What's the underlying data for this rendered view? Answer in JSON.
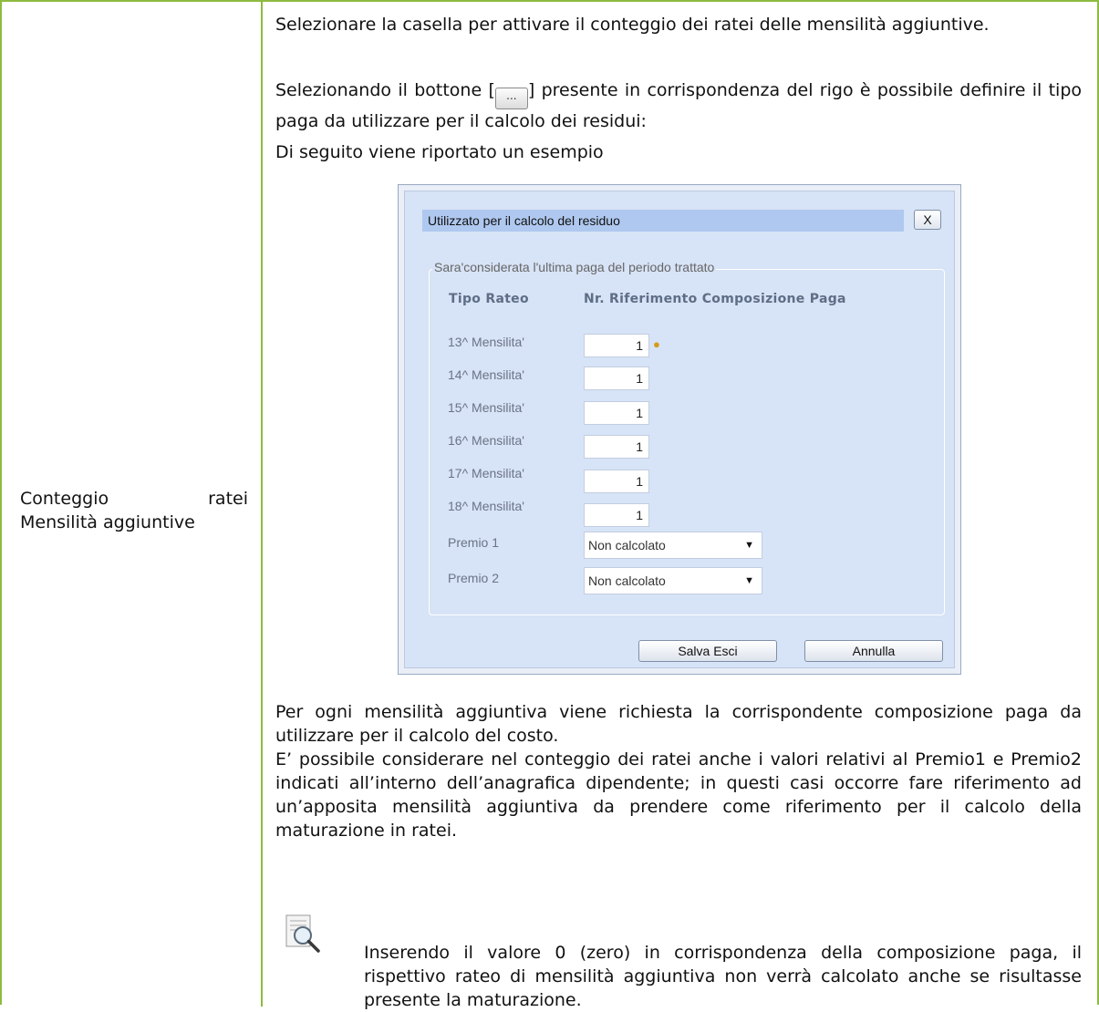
{
  "left_cell": {
    "label_line1_a": "Conteggio",
    "label_line1_b": "ratei",
    "label_line2": "Mensilità aggiuntive"
  },
  "right_cell": {
    "para1": "Selezionare la casella per attivare il conteggio dei ratei delle mensilità aggiuntive.",
    "para2_before": "Selezionando il bottone [",
    "inline_button_label": "...",
    "para2_after": "] presente in corrispondenza del rigo è possibile definire il tipo paga da utilizzare per il calcolo dei residui:",
    "para3": "Di seguito viene riportato un esempio",
    "para4": "Per ogni mensilità aggiuntiva viene richiesta la corrispondente composizione paga da utilizzare per il calcolo del costo.",
    "para5": "E’ possibile considerare nel conteggio dei ratei anche i valori relativi al Premio1 e Premio2 indicati all’interno dell’anagrafica dipendente; in questi casi occorre fare riferimento ad un’apposita mensilità aggiuntiva da prendere come riferimento per il calcolo della maturazione in ratei.",
    "note": "Inserendo il valore 0 (zero) in corrispondenza della composizione paga, il rispettivo rateo di mensilità aggiuntiva non verrà calcolato anche se risultasse presente la maturazione."
  },
  "dialog": {
    "title": "Utilizzato per il calcolo del residuo",
    "close_label": "X",
    "group_caption": "Sara'considerata l'ultima paga del periodo trattato",
    "col_header_tipo": "Tipo Rateo",
    "col_header_nr": "Nr. Riferimento Composizione Paga",
    "rows": [
      {
        "label": "13^ Mensilita'",
        "value": "1"
      },
      {
        "label": "14^ Mensilita'",
        "value": "1"
      },
      {
        "label": "15^ Mensilita'",
        "value": "1"
      },
      {
        "label": "16^ Mensilita'",
        "value": "1"
      },
      {
        "label": "17^ Mensilita'",
        "value": "1"
      },
      {
        "label": "18^ Mensilita'",
        "value": "1"
      }
    ],
    "premio1_label": "Premio 1",
    "premio1_value": "Non calcolato",
    "premio2_label": "Premio 2",
    "premio2_value": "Non calcolato",
    "save_label": "Salva Esci",
    "cancel_label": "Annulla"
  },
  "colors": {
    "table_border": "#8dbb3f",
    "dialog_bg": "#d7e3f6",
    "dialog_titlebar": "#afc8ef"
  }
}
